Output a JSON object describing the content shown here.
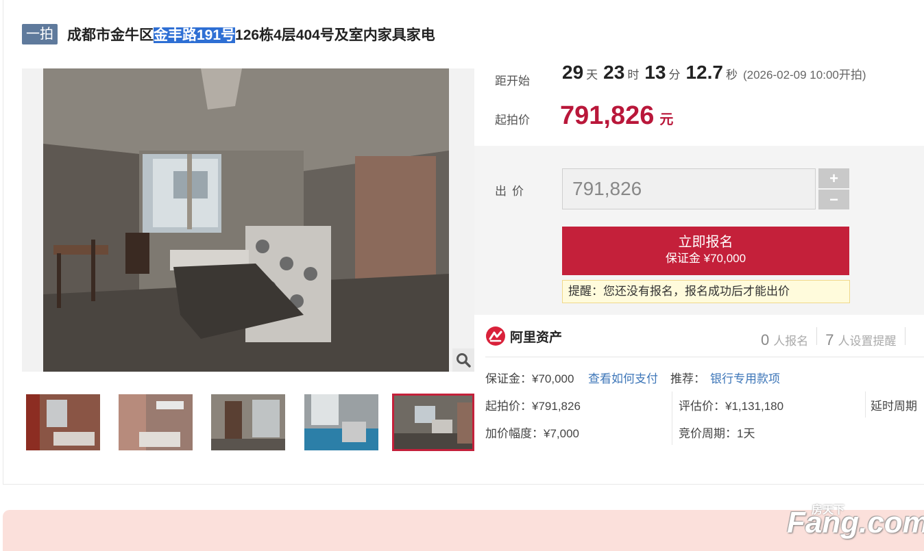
{
  "title": {
    "tag": "一拍",
    "pre": "成都市金牛区",
    "highlight": "金丰路191号",
    "post": "126栋4层404号及室内家具家电"
  },
  "countdown": {
    "label": "距开始",
    "days": "29",
    "days_unit": "天",
    "hours": "23",
    "hours_unit": "时",
    "minutes": "13",
    "minutes_unit": "分",
    "seconds": "12.7",
    "seconds_unit": "秒",
    "start": "(2026-02-09 10:00开拍)"
  },
  "starting_price": {
    "label": "起拍价",
    "value": "791,826",
    "unit": "元"
  },
  "bid": {
    "label": "出价",
    "input_value": "791,826",
    "plus": "+",
    "minus": "−",
    "signup_label": "立即报名",
    "signup_deposit": "保证金 ¥70,000",
    "notice": "提醒：您还没有报名，报名成功后才能出价"
  },
  "platform": {
    "name": "阿里资产",
    "signups_count": "0",
    "signups_label": "人报名",
    "reminders_count": "7",
    "reminders_label": "人设置提醒"
  },
  "details": {
    "deposit": "保证金：¥70,000",
    "how_to_pay": "查看如何支付",
    "recommend_label": "推荐：",
    "recommend_link": "银行专用款项",
    "start_price": "起拍价：¥791,826",
    "appraisal": "评估价：¥1,131,180",
    "delay": "延时周期",
    "increment": "加价幅度：¥7,000",
    "cycle": "竞价周期：1天"
  },
  "gallery": {
    "selected_index": 4,
    "thumb_count": 5
  },
  "watermark": "Fang.com",
  "watermark_cn": "房天下",
  "colors": {
    "accent": "#c4203a",
    "tag": "#5f7a9c",
    "link": "#3d76b8",
    "highlight": "#2e6fd4"
  },
  "icons": {
    "zoom": "magnifier-icon",
    "brand": "ali-asset-logo-icon"
  }
}
